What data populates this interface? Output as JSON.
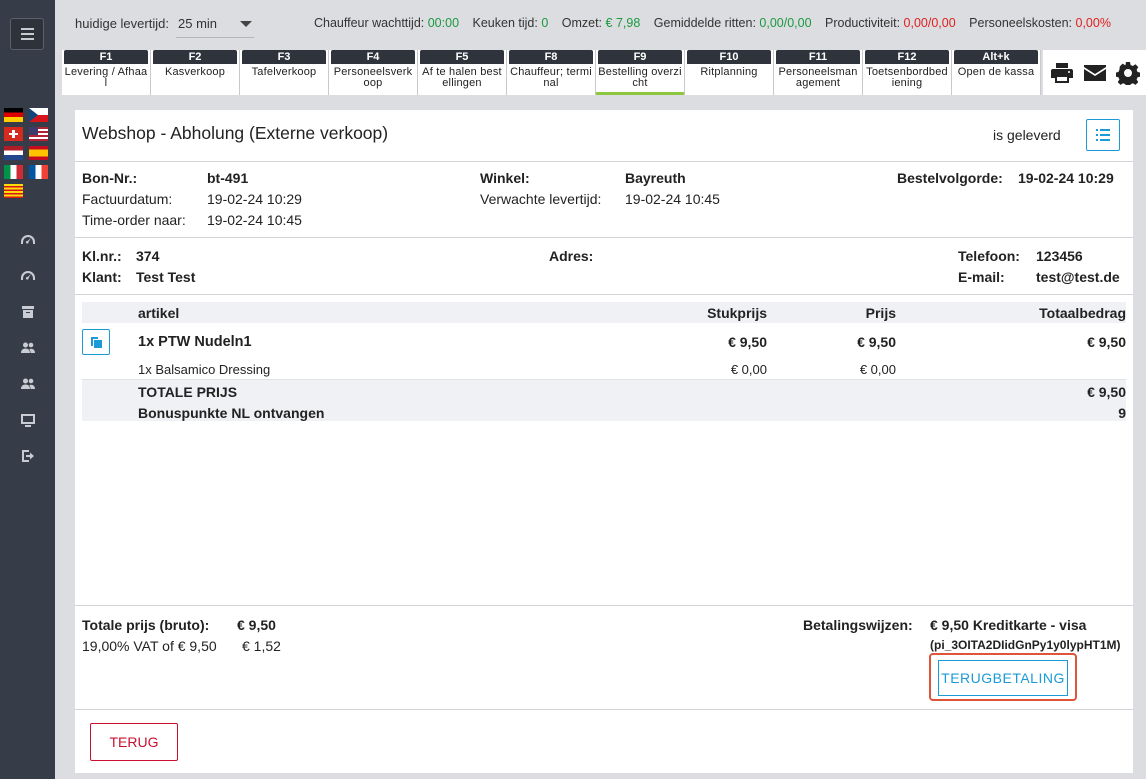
{
  "topbar": {
    "levertijd_label": "huidige levertijd:",
    "levertijd_value": "25 min",
    "stats": [
      {
        "label": "Chauffeur wachttijd:",
        "value": "00:00",
        "color": "green"
      },
      {
        "label": "Keuken tijd:",
        "value": "0",
        "color": "green"
      },
      {
        "label": "Omzet:",
        "value": "€ 7,98",
        "color": "green"
      },
      {
        "label": "Gemiddelde ritten:",
        "value": "0,00/0,00",
        "color": "green"
      },
      {
        "label": "Productiviteit:",
        "value": "0,00/0,00",
        "color": "red"
      },
      {
        "label": "Personeelskosten:",
        "value": "0,00%",
        "color": "red"
      }
    ]
  },
  "fkeys": [
    {
      "key": "F1",
      "label": "Levering / Afhaal"
    },
    {
      "key": "F2",
      "label": "Kasverkoop"
    },
    {
      "key": "F3",
      "label": "Tafelverkoop"
    },
    {
      "key": "F4",
      "label": "Personeelsverkoop"
    },
    {
      "key": "F5",
      "label": "Af te halen bestellingen"
    },
    {
      "key": "F8",
      "label": "Chauffeur; terminal"
    },
    {
      "key": "F9",
      "label": "Bestelling overzicht"
    },
    {
      "key": "F10",
      "label": "Ritplanning"
    },
    {
      "key": "F11",
      "label": "Personeelsmanagement"
    },
    {
      "key": "F12",
      "label": "Toetsenbordbediening"
    },
    {
      "key": "Alt+k",
      "label": "Open de kassa"
    }
  ],
  "order": {
    "title": "Webshop - Abholung (Externe verkoop)",
    "status": "is geleverd",
    "bon_label": "Bon-Nr.:",
    "bon_value": "bt-491",
    "factuur_label": "Factuurdatum:",
    "factuur_value": "19-02-24 10:29",
    "timeorder_label": "Time-order naar:",
    "timeorder_value": "19-02-24 10:45",
    "winkel_label": "Winkel:",
    "winkel_value": "Bayreuth",
    "verwacht_label": "Verwachte levertijd:",
    "verwacht_value": "19-02-24 10:45",
    "bestelvolg_label": "Bestelvolgorde:",
    "bestelvolg_value": "19-02-24 10:29"
  },
  "customer": {
    "klnr_label": "Kl.nr.:",
    "klnr_value": "374",
    "klant_label": "Klant:",
    "klant_value": "Test Test",
    "adres_label": "Adres:",
    "telefoon_label": "Telefoon:",
    "telefoon_value": "123456",
    "email_label": "E-mail:",
    "email_value": "test@test.de"
  },
  "table": {
    "headers": {
      "artikel": "artikel",
      "stukprijs": "Stukprijs",
      "prijs": "Prijs",
      "totaal": "Totaalbedrag"
    },
    "item": {
      "name": "1x PTW Nudeln1",
      "stukprijs": "€ 9,50",
      "prijs": "€ 9,50",
      "totaal": "€ 9,50"
    },
    "sub": {
      "name": "1x Balsamico Dressing",
      "stukprijs": "€ 0,00",
      "prijs": "€ 0,00"
    },
    "total_label": "TOTALE PRIJS",
    "total_value": "€ 9,50",
    "bonus_label": "Bonuspunkte NL ontvangen",
    "bonus_value": "9"
  },
  "footer": {
    "bruto_label": "Totale prijs (bruto):",
    "bruto_value": "€ 9,50",
    "vat_label": "19,00% VAT of € 9,50",
    "vat_value": "€ 1,52",
    "betaling_label": "Betalingswijzen:",
    "betaling_value": "€ 9,50 Kreditkarte - visa",
    "betaling_ref": "(pi_3OITA2DIidGnPy1y0lypHT1M)",
    "refund_label": "TERUGBETALING",
    "back_label": "TERUG"
  }
}
